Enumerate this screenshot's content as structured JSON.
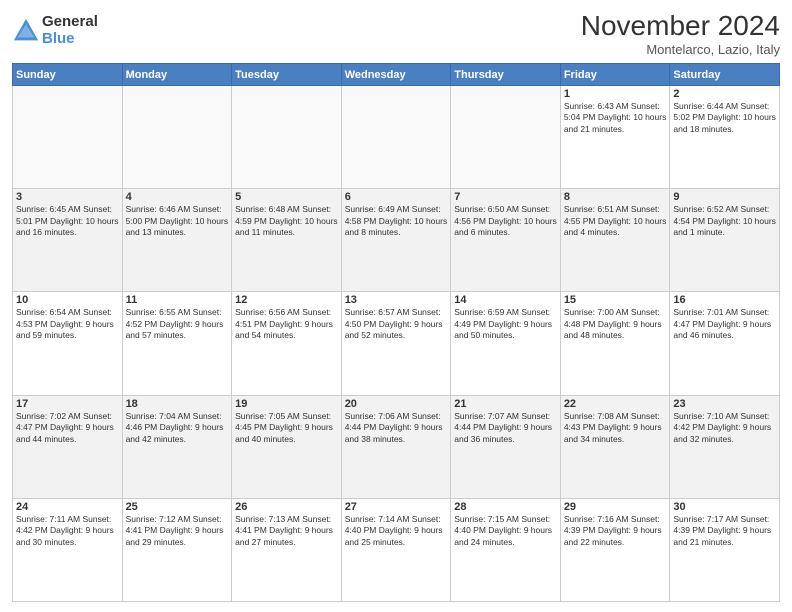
{
  "header": {
    "logo_general": "General",
    "logo_blue": "Blue",
    "month_title": "November 2024",
    "location": "Montelarco, Lazio, Italy"
  },
  "days_of_week": [
    "Sunday",
    "Monday",
    "Tuesday",
    "Wednesday",
    "Thursday",
    "Friday",
    "Saturday"
  ],
  "weeks": [
    {
      "shaded": false,
      "days": [
        {
          "num": "",
          "info": ""
        },
        {
          "num": "",
          "info": ""
        },
        {
          "num": "",
          "info": ""
        },
        {
          "num": "",
          "info": ""
        },
        {
          "num": "",
          "info": ""
        },
        {
          "num": "1",
          "info": "Sunrise: 6:43 AM\nSunset: 5:04 PM\nDaylight: 10 hours\nand 21 minutes."
        },
        {
          "num": "2",
          "info": "Sunrise: 6:44 AM\nSunset: 5:02 PM\nDaylight: 10 hours\nand 18 minutes."
        }
      ]
    },
    {
      "shaded": true,
      "days": [
        {
          "num": "3",
          "info": "Sunrise: 6:45 AM\nSunset: 5:01 PM\nDaylight: 10 hours\nand 16 minutes."
        },
        {
          "num": "4",
          "info": "Sunrise: 6:46 AM\nSunset: 5:00 PM\nDaylight: 10 hours\nand 13 minutes."
        },
        {
          "num": "5",
          "info": "Sunrise: 6:48 AM\nSunset: 4:59 PM\nDaylight: 10 hours\nand 11 minutes."
        },
        {
          "num": "6",
          "info": "Sunrise: 6:49 AM\nSunset: 4:58 PM\nDaylight: 10 hours\nand 8 minutes."
        },
        {
          "num": "7",
          "info": "Sunrise: 6:50 AM\nSunset: 4:56 PM\nDaylight: 10 hours\nand 6 minutes."
        },
        {
          "num": "8",
          "info": "Sunrise: 6:51 AM\nSunset: 4:55 PM\nDaylight: 10 hours\nand 4 minutes."
        },
        {
          "num": "9",
          "info": "Sunrise: 6:52 AM\nSunset: 4:54 PM\nDaylight: 10 hours\nand 1 minute."
        }
      ]
    },
    {
      "shaded": false,
      "days": [
        {
          "num": "10",
          "info": "Sunrise: 6:54 AM\nSunset: 4:53 PM\nDaylight: 9 hours\nand 59 minutes."
        },
        {
          "num": "11",
          "info": "Sunrise: 6:55 AM\nSunset: 4:52 PM\nDaylight: 9 hours\nand 57 minutes."
        },
        {
          "num": "12",
          "info": "Sunrise: 6:56 AM\nSunset: 4:51 PM\nDaylight: 9 hours\nand 54 minutes."
        },
        {
          "num": "13",
          "info": "Sunrise: 6:57 AM\nSunset: 4:50 PM\nDaylight: 9 hours\nand 52 minutes."
        },
        {
          "num": "14",
          "info": "Sunrise: 6:59 AM\nSunset: 4:49 PM\nDaylight: 9 hours\nand 50 minutes."
        },
        {
          "num": "15",
          "info": "Sunrise: 7:00 AM\nSunset: 4:48 PM\nDaylight: 9 hours\nand 48 minutes."
        },
        {
          "num": "16",
          "info": "Sunrise: 7:01 AM\nSunset: 4:47 PM\nDaylight: 9 hours\nand 46 minutes."
        }
      ]
    },
    {
      "shaded": true,
      "days": [
        {
          "num": "17",
          "info": "Sunrise: 7:02 AM\nSunset: 4:47 PM\nDaylight: 9 hours\nand 44 minutes."
        },
        {
          "num": "18",
          "info": "Sunrise: 7:04 AM\nSunset: 4:46 PM\nDaylight: 9 hours\nand 42 minutes."
        },
        {
          "num": "19",
          "info": "Sunrise: 7:05 AM\nSunset: 4:45 PM\nDaylight: 9 hours\nand 40 minutes."
        },
        {
          "num": "20",
          "info": "Sunrise: 7:06 AM\nSunset: 4:44 PM\nDaylight: 9 hours\nand 38 minutes."
        },
        {
          "num": "21",
          "info": "Sunrise: 7:07 AM\nSunset: 4:44 PM\nDaylight: 9 hours\nand 36 minutes."
        },
        {
          "num": "22",
          "info": "Sunrise: 7:08 AM\nSunset: 4:43 PM\nDaylight: 9 hours\nand 34 minutes."
        },
        {
          "num": "23",
          "info": "Sunrise: 7:10 AM\nSunset: 4:42 PM\nDaylight: 9 hours\nand 32 minutes."
        }
      ]
    },
    {
      "shaded": false,
      "days": [
        {
          "num": "24",
          "info": "Sunrise: 7:11 AM\nSunset: 4:42 PM\nDaylight: 9 hours\nand 30 minutes."
        },
        {
          "num": "25",
          "info": "Sunrise: 7:12 AM\nSunset: 4:41 PM\nDaylight: 9 hours\nand 29 minutes."
        },
        {
          "num": "26",
          "info": "Sunrise: 7:13 AM\nSunset: 4:41 PM\nDaylight: 9 hours\nand 27 minutes."
        },
        {
          "num": "27",
          "info": "Sunrise: 7:14 AM\nSunset: 4:40 PM\nDaylight: 9 hours\nand 25 minutes."
        },
        {
          "num": "28",
          "info": "Sunrise: 7:15 AM\nSunset: 4:40 PM\nDaylight: 9 hours\nand 24 minutes."
        },
        {
          "num": "29",
          "info": "Sunrise: 7:16 AM\nSunset: 4:39 PM\nDaylight: 9 hours\nand 22 minutes."
        },
        {
          "num": "30",
          "info": "Sunrise: 7:17 AM\nSunset: 4:39 PM\nDaylight: 9 hours\nand 21 minutes."
        }
      ]
    }
  ]
}
